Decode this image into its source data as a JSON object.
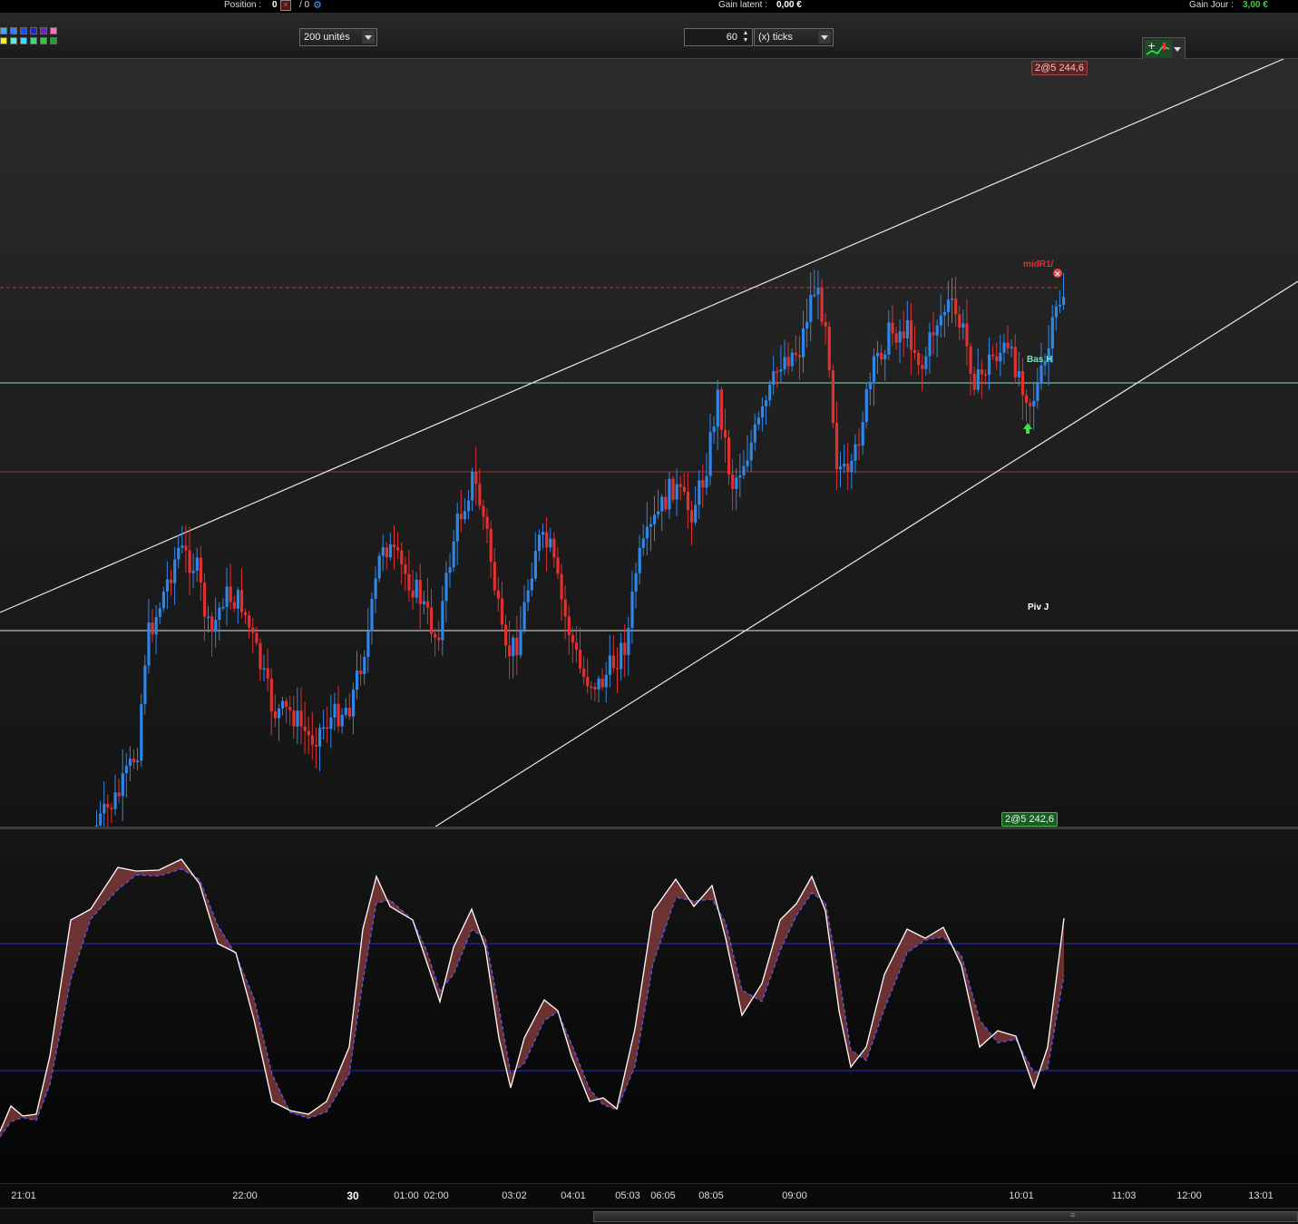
{
  "topbar": {
    "position_label": "Position :",
    "position_value": "0",
    "position_sep": "/ 0",
    "gain_latent_label": "Gain latent :",
    "gain_latent_value": "0,00 €",
    "gain_jour_label": "Gain Jour :",
    "gain_jour_value": "3,00 €"
  },
  "toolbar": {
    "units_select": "200 unités",
    "ticks_number": "60",
    "ticks_select": "(x) ticks"
  },
  "palette_colors": [
    "#3fa9ff",
    "#2e86ff",
    "#1b4dff",
    "#2222cc",
    "#6a1fd0",
    "#ff6fc8",
    "#f2f21f",
    "#5cf0d0",
    "#3ae0ff",
    "#37e07a",
    "#2ecf3a",
    "#1fa22a"
  ],
  "chart": {
    "high_order_tag": "2@5 244,6",
    "low_order_tag": "2@5 242,6",
    "label_midr1": "midR1/",
    "label_bas_h": "Bas H",
    "label_piv_j": "Piv J",
    "colors": {
      "up": "#2e86e8",
      "down": "#e03030",
      "stoch_k": "#ffffff",
      "stoch_d": "#5a5aff",
      "band": "#8c3d3d"
    }
  },
  "time_axis": [
    "21:01",
    "22:00",
    "30",
    "01:00",
    "02:00",
    "03:02",
    "04:01",
    "05:03",
    "06:05",
    "08:05",
    "09:00",
    "10:01",
    "11:03",
    "12:00",
    "13:01"
  ]
}
